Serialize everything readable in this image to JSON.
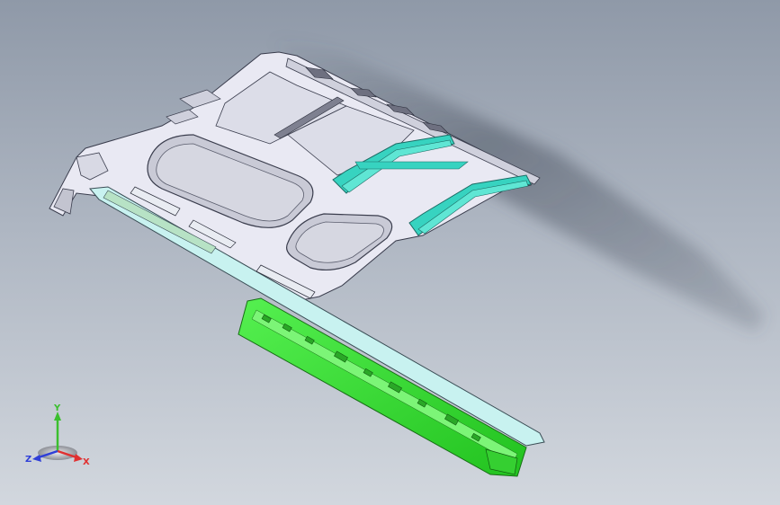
{
  "viewport": {
    "background_top": "#8f99a8",
    "background_bottom": "#d2d7de"
  },
  "model": {
    "roof_panel_color": "#e9e9f3",
    "roof_edge_color": "#3a3d4d",
    "bow_color": "#37d3c0",
    "side_rail_color": "#c8f2f0",
    "lower_rail_color": "#3de83a",
    "shadow_color": "#4d5563"
  },
  "triad": {
    "y_label": "Y",
    "x_label": "X",
    "z_label": "Z",
    "y_color": "#3bbf2e",
    "x_color": "#e03131",
    "z_color": "#2f3fd8"
  }
}
